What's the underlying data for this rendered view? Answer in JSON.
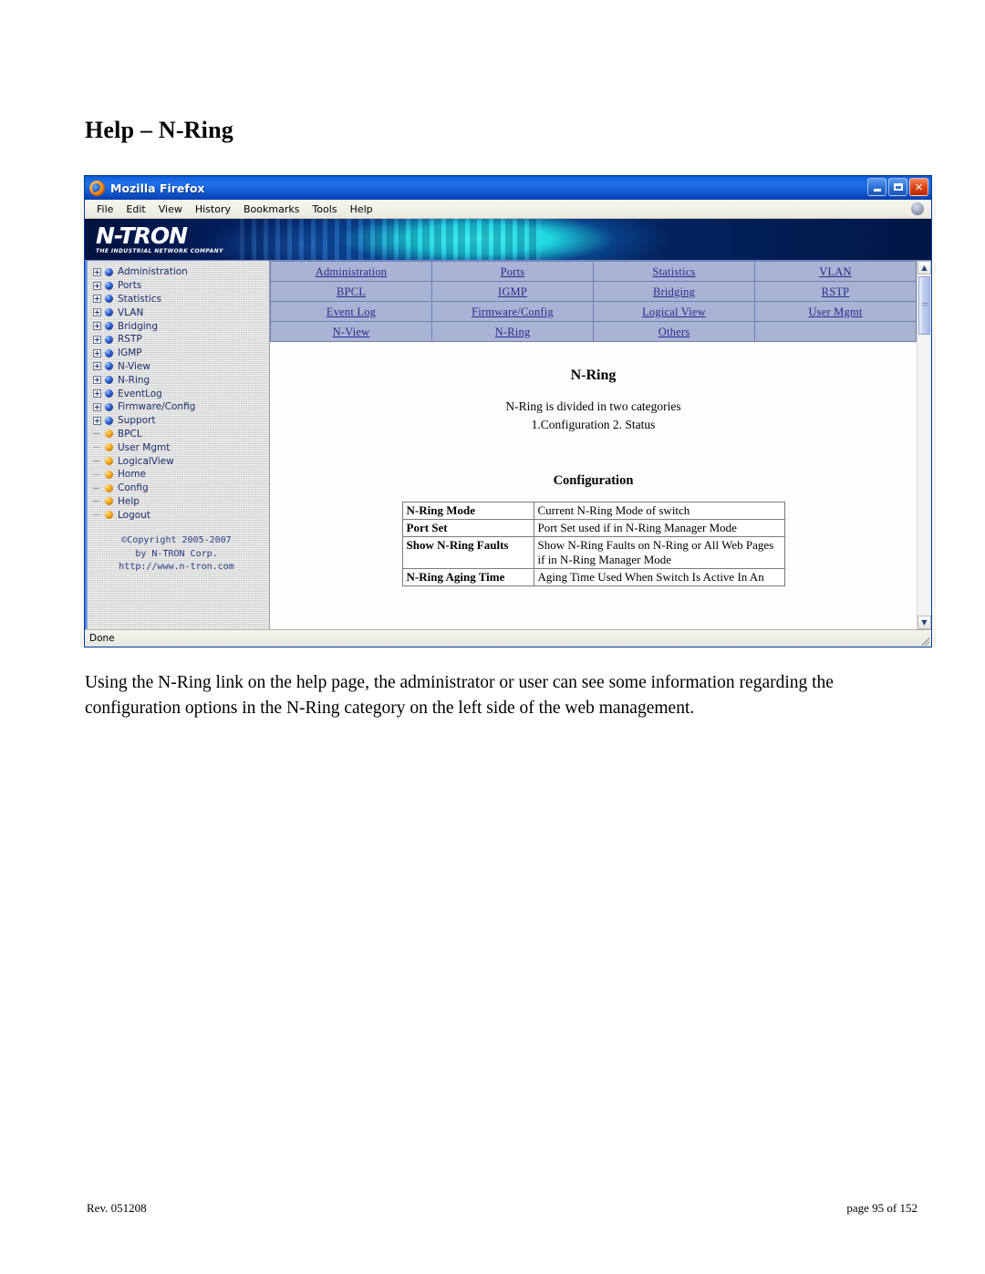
{
  "document": {
    "title": "Help – N-Ring",
    "paragraph": "Using the N-Ring link on the help page, the administrator or user can see some information regarding the configuration options in the N-Ring category on the left side of the web management.",
    "footer_left": "Rev.  051208",
    "footer_right": "page 95 of 152"
  },
  "browser": {
    "window_title": "Mozilla Firefox",
    "app_icon": "firefox-icon",
    "window_controls": {
      "minimize": "minimize-icon",
      "maximize": "maximize-icon",
      "close": "close-icon"
    },
    "menu": [
      {
        "label": "File",
        "accel": "F"
      },
      {
        "label": "Edit",
        "accel": "E"
      },
      {
        "label": "View",
        "accel": "V"
      },
      {
        "label": "History",
        "accel": "s"
      },
      {
        "label": "Bookmarks",
        "accel": "B"
      },
      {
        "label": "Tools",
        "accel": "T"
      },
      {
        "label": "Help",
        "accel": "H"
      }
    ],
    "status": "Done"
  },
  "banner": {
    "wordmark": "N-TRON",
    "tagline": "THE INDUSTRIAL NETWORK COMPANY"
  },
  "sidebar": {
    "tree": [
      {
        "label": "Administration",
        "icon": "blue-sphere-icon",
        "expandable": true
      },
      {
        "label": "Ports",
        "icon": "blue-sphere-icon",
        "expandable": true
      },
      {
        "label": "Statistics",
        "icon": "blue-sphere-icon",
        "expandable": true
      },
      {
        "label": "VLAN",
        "icon": "blue-sphere-icon",
        "expandable": true
      },
      {
        "label": "Bridging",
        "icon": "blue-sphere-icon",
        "expandable": true
      },
      {
        "label": "RSTP",
        "icon": "blue-sphere-icon",
        "expandable": true
      },
      {
        "label": "IGMP",
        "icon": "blue-sphere-icon",
        "expandable": true
      },
      {
        "label": "N-View",
        "icon": "blue-sphere-icon",
        "expandable": true
      },
      {
        "label": "N-Ring",
        "icon": "blue-sphere-icon",
        "expandable": true
      },
      {
        "label": "EventLog",
        "icon": "blue-sphere-icon",
        "expandable": true
      },
      {
        "label": "Firmware/Config",
        "icon": "blue-sphere-icon",
        "expandable": true
      },
      {
        "label": "Support",
        "icon": "blue-sphere-icon",
        "expandable": true
      },
      {
        "label": "BPCL",
        "icon": "orange-sphere-icon",
        "expandable": false
      },
      {
        "label": "User Mgmt",
        "icon": "orange-sphere-icon",
        "expandable": false
      },
      {
        "label": "LogicalView",
        "icon": "orange-sphere-icon",
        "expandable": false
      },
      {
        "label": "Home",
        "icon": "orange-sphere-icon",
        "expandable": false
      },
      {
        "label": "Config",
        "icon": "orange-sphere-icon",
        "expandable": false
      },
      {
        "label": "Help",
        "icon": "orange-sphere-icon",
        "expandable": false
      },
      {
        "label": "Logout",
        "icon": "orange-sphere-icon",
        "expandable": false
      }
    ],
    "copyright": [
      "©Copyright 2005-2007",
      "by N-TRON Corp.",
      "http://www.n-tron.com"
    ]
  },
  "link_grid": {
    "rows": [
      [
        "Administration",
        "Ports",
        "Statistics",
        "VLAN"
      ],
      [
        "BPCL",
        "IGMP",
        "Bridging",
        "RSTP"
      ],
      [
        "Event Log",
        "Firmware/Config",
        "Logical View",
        "User Mgmt"
      ],
      [
        "N-View",
        "N-Ring",
        "Others",
        ""
      ]
    ]
  },
  "help_page": {
    "heading": "N-Ring",
    "intro_line1": "N-Ring is divided in two categories",
    "intro_line2": "1.Configuration   2. Status",
    "section_heading": "Configuration",
    "config_rows": [
      {
        "key": "N-Ring Mode",
        "value": "Current N-Ring Mode of switch"
      },
      {
        "key": "Port Set",
        "value": "Port Set used if in N-Ring Manager Mode"
      },
      {
        "key": "Show N-Ring Faults",
        "value": "Show N-Ring Faults on N-Ring or All Web Pages if in N-Ring Manager Mode"
      },
      {
        "key": "N-Ring Aging Time",
        "value": "Aging Time Used When Switch Is Active In An"
      }
    ]
  },
  "colors": {
    "titlebar_blue": "#1e6fe8",
    "link_cell": "#a9b4d4",
    "link_text": "#2a2a8c",
    "tree_text": "#1c2e6e",
    "banner_cyan": "#35f6ee"
  }
}
